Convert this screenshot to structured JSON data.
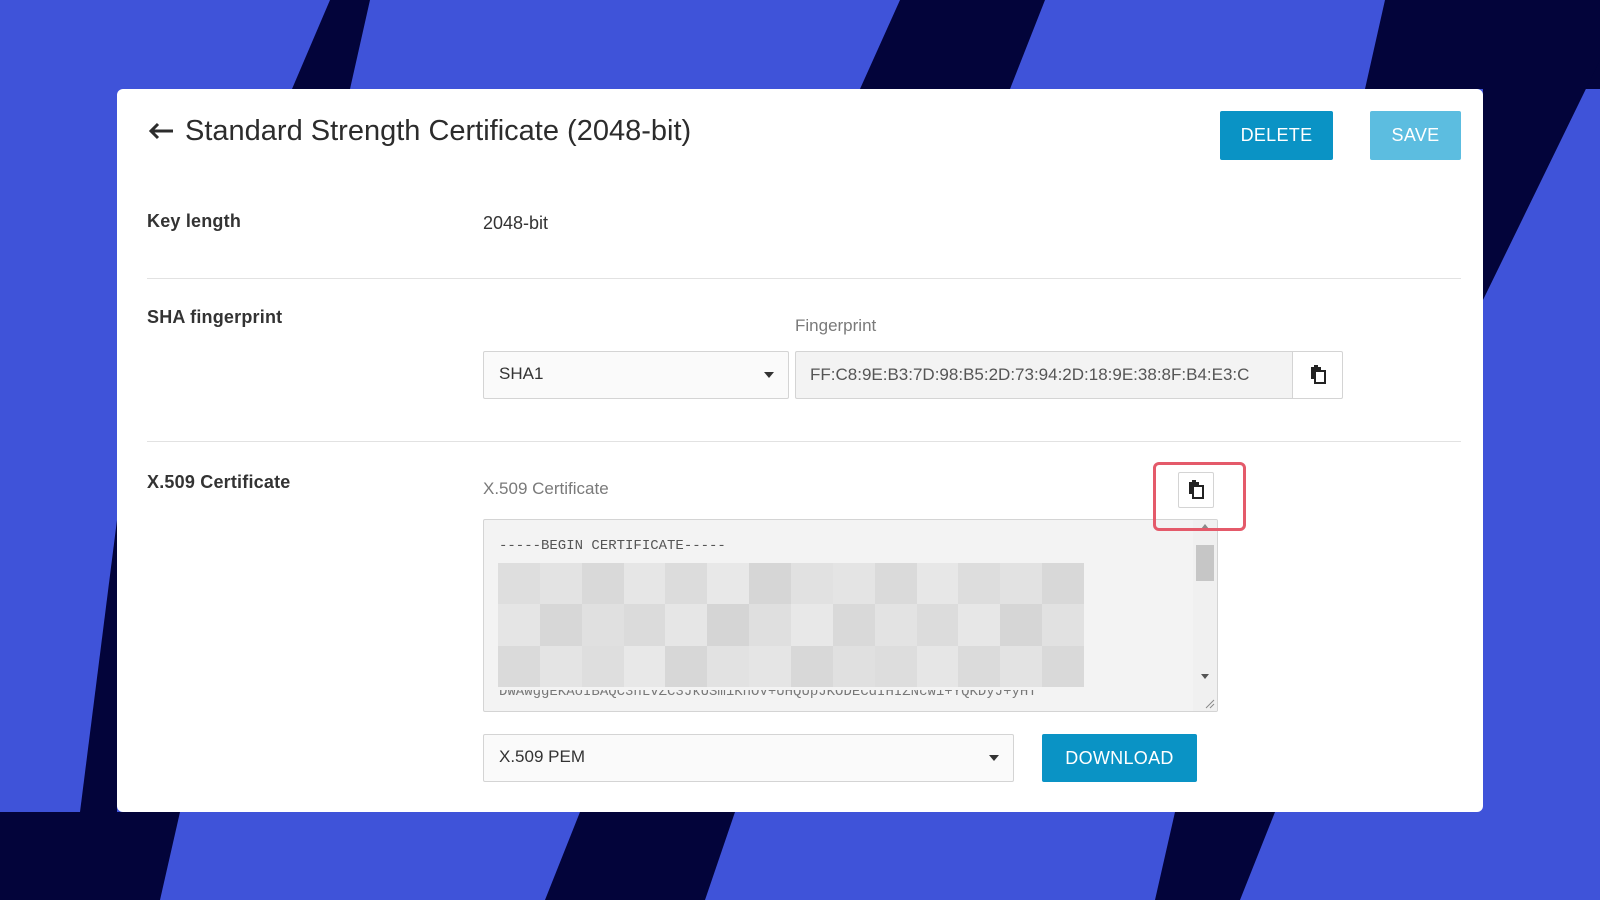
{
  "header": {
    "title": "Standard Strength Certificate (2048-bit)",
    "delete_label": "DELETE",
    "save_label": "SAVE"
  },
  "key_length": {
    "label": "Key length",
    "value": "2048-bit"
  },
  "sha_fingerprint": {
    "label": "SHA fingerprint",
    "algorithm_selected": "SHA1",
    "fingerprint_label": "Fingerprint",
    "fingerprint_value": "FF:C8:9E:B3:7D:98:B5:2D:73:94:2D:18:9E:38:8F:B4:E3:C"
  },
  "x509": {
    "label": "X.509 Certificate",
    "field_label": "X.509 Certificate",
    "begin_line": "-----BEGIN CERTIFICATE-----",
    "partial_line": "DWAwggEKAoIBAQC3hLvZC3JkUSm1KhOV+UHQUpJKODECdIHIZNcw1+YQKDyJ+yHT",
    "format_selected": "X.509 PEM",
    "download_label": "DOWNLOAD"
  },
  "icons": {
    "back": "arrow-left-icon",
    "copy": "clipboard-copy-icon",
    "dropdown": "caret-down-icon"
  },
  "colors": {
    "background": "#3f53d9",
    "stripes": "#03043a",
    "primary_button": "#0a93c5",
    "save_button": "#5cbde0",
    "highlight": "#e45a6a"
  }
}
